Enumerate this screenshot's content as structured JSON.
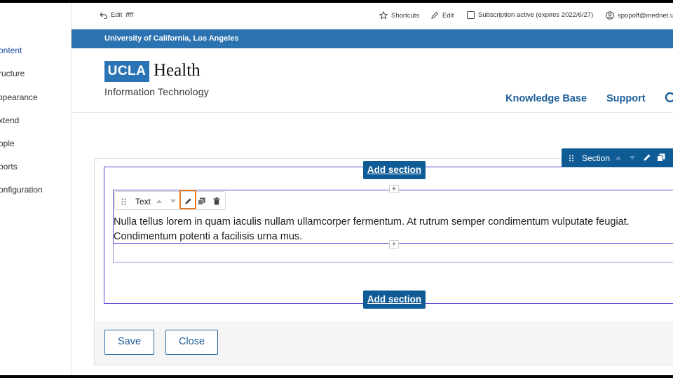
{
  "admin_menu": {
    "items": [
      {
        "label": "ontent",
        "active": true
      },
      {
        "label": "ructure"
      },
      {
        "label": "ppearance"
      },
      {
        "label": "xtend"
      },
      {
        "label": "ople"
      },
      {
        "label": "ports"
      },
      {
        "label": "onfiguration"
      }
    ]
  },
  "toolbar": {
    "edit_prefix": "Edit",
    "edit_title": "ffff",
    "shortcuts": "Shortcuts",
    "edit": "Edit",
    "subscription": "Subscription active (expires 2022/6/27)",
    "user": "spopoff@mednet.u"
  },
  "site": {
    "university": "University of California, Los Angeles",
    "logo_text": "UCLA",
    "logo_health": "Health",
    "logo_sub": "Information Technology",
    "nav": [
      "Knowledge Base",
      "Support"
    ]
  },
  "layout_builder": {
    "add_section_label": "Add section",
    "section_toolbar_label": "Section",
    "block_toolbar_label": "Text",
    "block_text": "Nulla tellus lorem in quam iaculis nullam ullamcorper fermentum. At rutrum semper condimentum vulputate feugiat. Condimentum potenti a facilisis urna mus.",
    "plus": "+"
  },
  "actions": {
    "save": "Save",
    "close": "Close"
  },
  "colors": {
    "brand_blue": "#2a72b0",
    "button_blue": "#0f5b96",
    "outline_purple": "#5645d6",
    "highlight_orange": "#e87722"
  }
}
